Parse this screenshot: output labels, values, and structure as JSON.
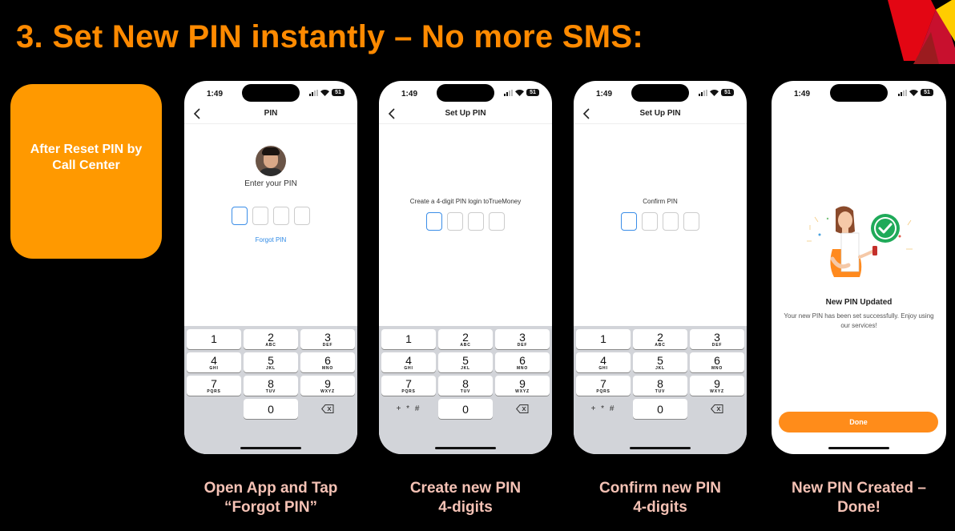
{
  "slide": {
    "title": "3. Set New PIN instantly – No more SMS:",
    "reset_box": "After Reset PIN by\nCall Center",
    "colors": {
      "accent": "#ff8a00",
      "box": "#ff9900",
      "caption": "#f5c2b5",
      "link": "#2f8ae6"
    }
  },
  "status_bar": {
    "time": "1:49",
    "battery": "51"
  },
  "keypad": {
    "rows": [
      [
        {
          "n": "1",
          "l": ""
        },
        {
          "n": "2",
          "l": "ABC"
        },
        {
          "n": "3",
          "l": "DEF"
        }
      ],
      [
        {
          "n": "4",
          "l": "GHI"
        },
        {
          "n": "5",
          "l": "JKL"
        },
        {
          "n": "6",
          "l": "MNO"
        }
      ],
      [
        {
          "n": "7",
          "l": "PQRS"
        },
        {
          "n": "8",
          "l": "TUV"
        },
        {
          "n": "9",
          "l": "WXYZ"
        }
      ]
    ],
    "zero": "0",
    "symbols": "+ * #"
  },
  "screens": {
    "pin": {
      "title": "PIN",
      "prompt": "Enter your PIN",
      "forgot": "Forgot PIN"
    },
    "setup": {
      "title": "Set Up PIN",
      "prompt": "Create a 4-digit PIN login toTrueMoney"
    },
    "confirm": {
      "title": "Set Up PIN",
      "prompt": "Confirm PIN"
    },
    "success": {
      "title": "New PIN Updated",
      "message": "Your new PIN has been set successfully. Enjoy using our services!",
      "done": "Done"
    }
  },
  "captions": {
    "c1": "Open App and Tap\n“Forgot PIN”",
    "c2": "Create new PIN\n4-digits",
    "c3": "Confirm new PIN\n4-digits",
    "c4": "New PIN Created –\nDone!"
  }
}
